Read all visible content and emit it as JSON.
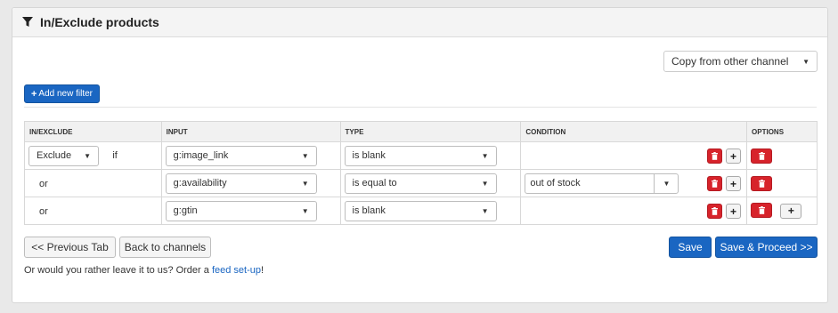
{
  "panel": {
    "title": "In/Exclude products",
    "icon": "filter-icon"
  },
  "copy_select": {
    "value": "Copy from other channel"
  },
  "add_filter": {
    "label": "Add new filter"
  },
  "table": {
    "headers": [
      "IN/EXCLUDE",
      "INPUT",
      "TYPE",
      "CONDITION",
      "OPTIONS"
    ],
    "rows": [
      {
        "prefix_select": "Exclude",
        "prefix_word": "if",
        "input": "g:image_link",
        "type": "is blank",
        "condition": ""
      },
      {
        "prefix_word": "or",
        "input": "g:availability",
        "type": "is equal to",
        "condition": "out of stock"
      },
      {
        "prefix_word": "or",
        "input": "g:gtin",
        "type": "is blank",
        "condition": ""
      }
    ]
  },
  "buttons": {
    "prev_tab": "<< Previous Tab",
    "back_channels": "Back to channels",
    "save": "Save",
    "save_proceed": "Save & Proceed >>"
  },
  "footer": {
    "prefix": "Or would you rather leave it to us? Order a ",
    "link": "feed set-up",
    "suffix": "!"
  },
  "colors": {
    "primary": "#1a66c2",
    "danger": "#d7232b"
  }
}
